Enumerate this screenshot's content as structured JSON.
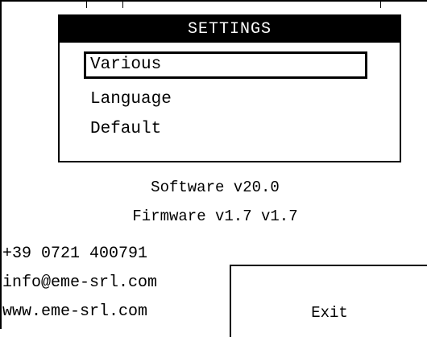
{
  "menu": {
    "title": "SETTINGS",
    "items": [
      {
        "label": "Various",
        "selected": true
      },
      {
        "label": "Language",
        "selected": false
      },
      {
        "label": "Default",
        "selected": false
      }
    ]
  },
  "info": {
    "software": "Software v20.0",
    "firmware": "Firmware v1.7 v1.7"
  },
  "contact": {
    "phone": "+39 0721 400791",
    "email": "info@eme-srl.com",
    "website": "www.eme-srl.com"
  },
  "exit_label": "Exit"
}
